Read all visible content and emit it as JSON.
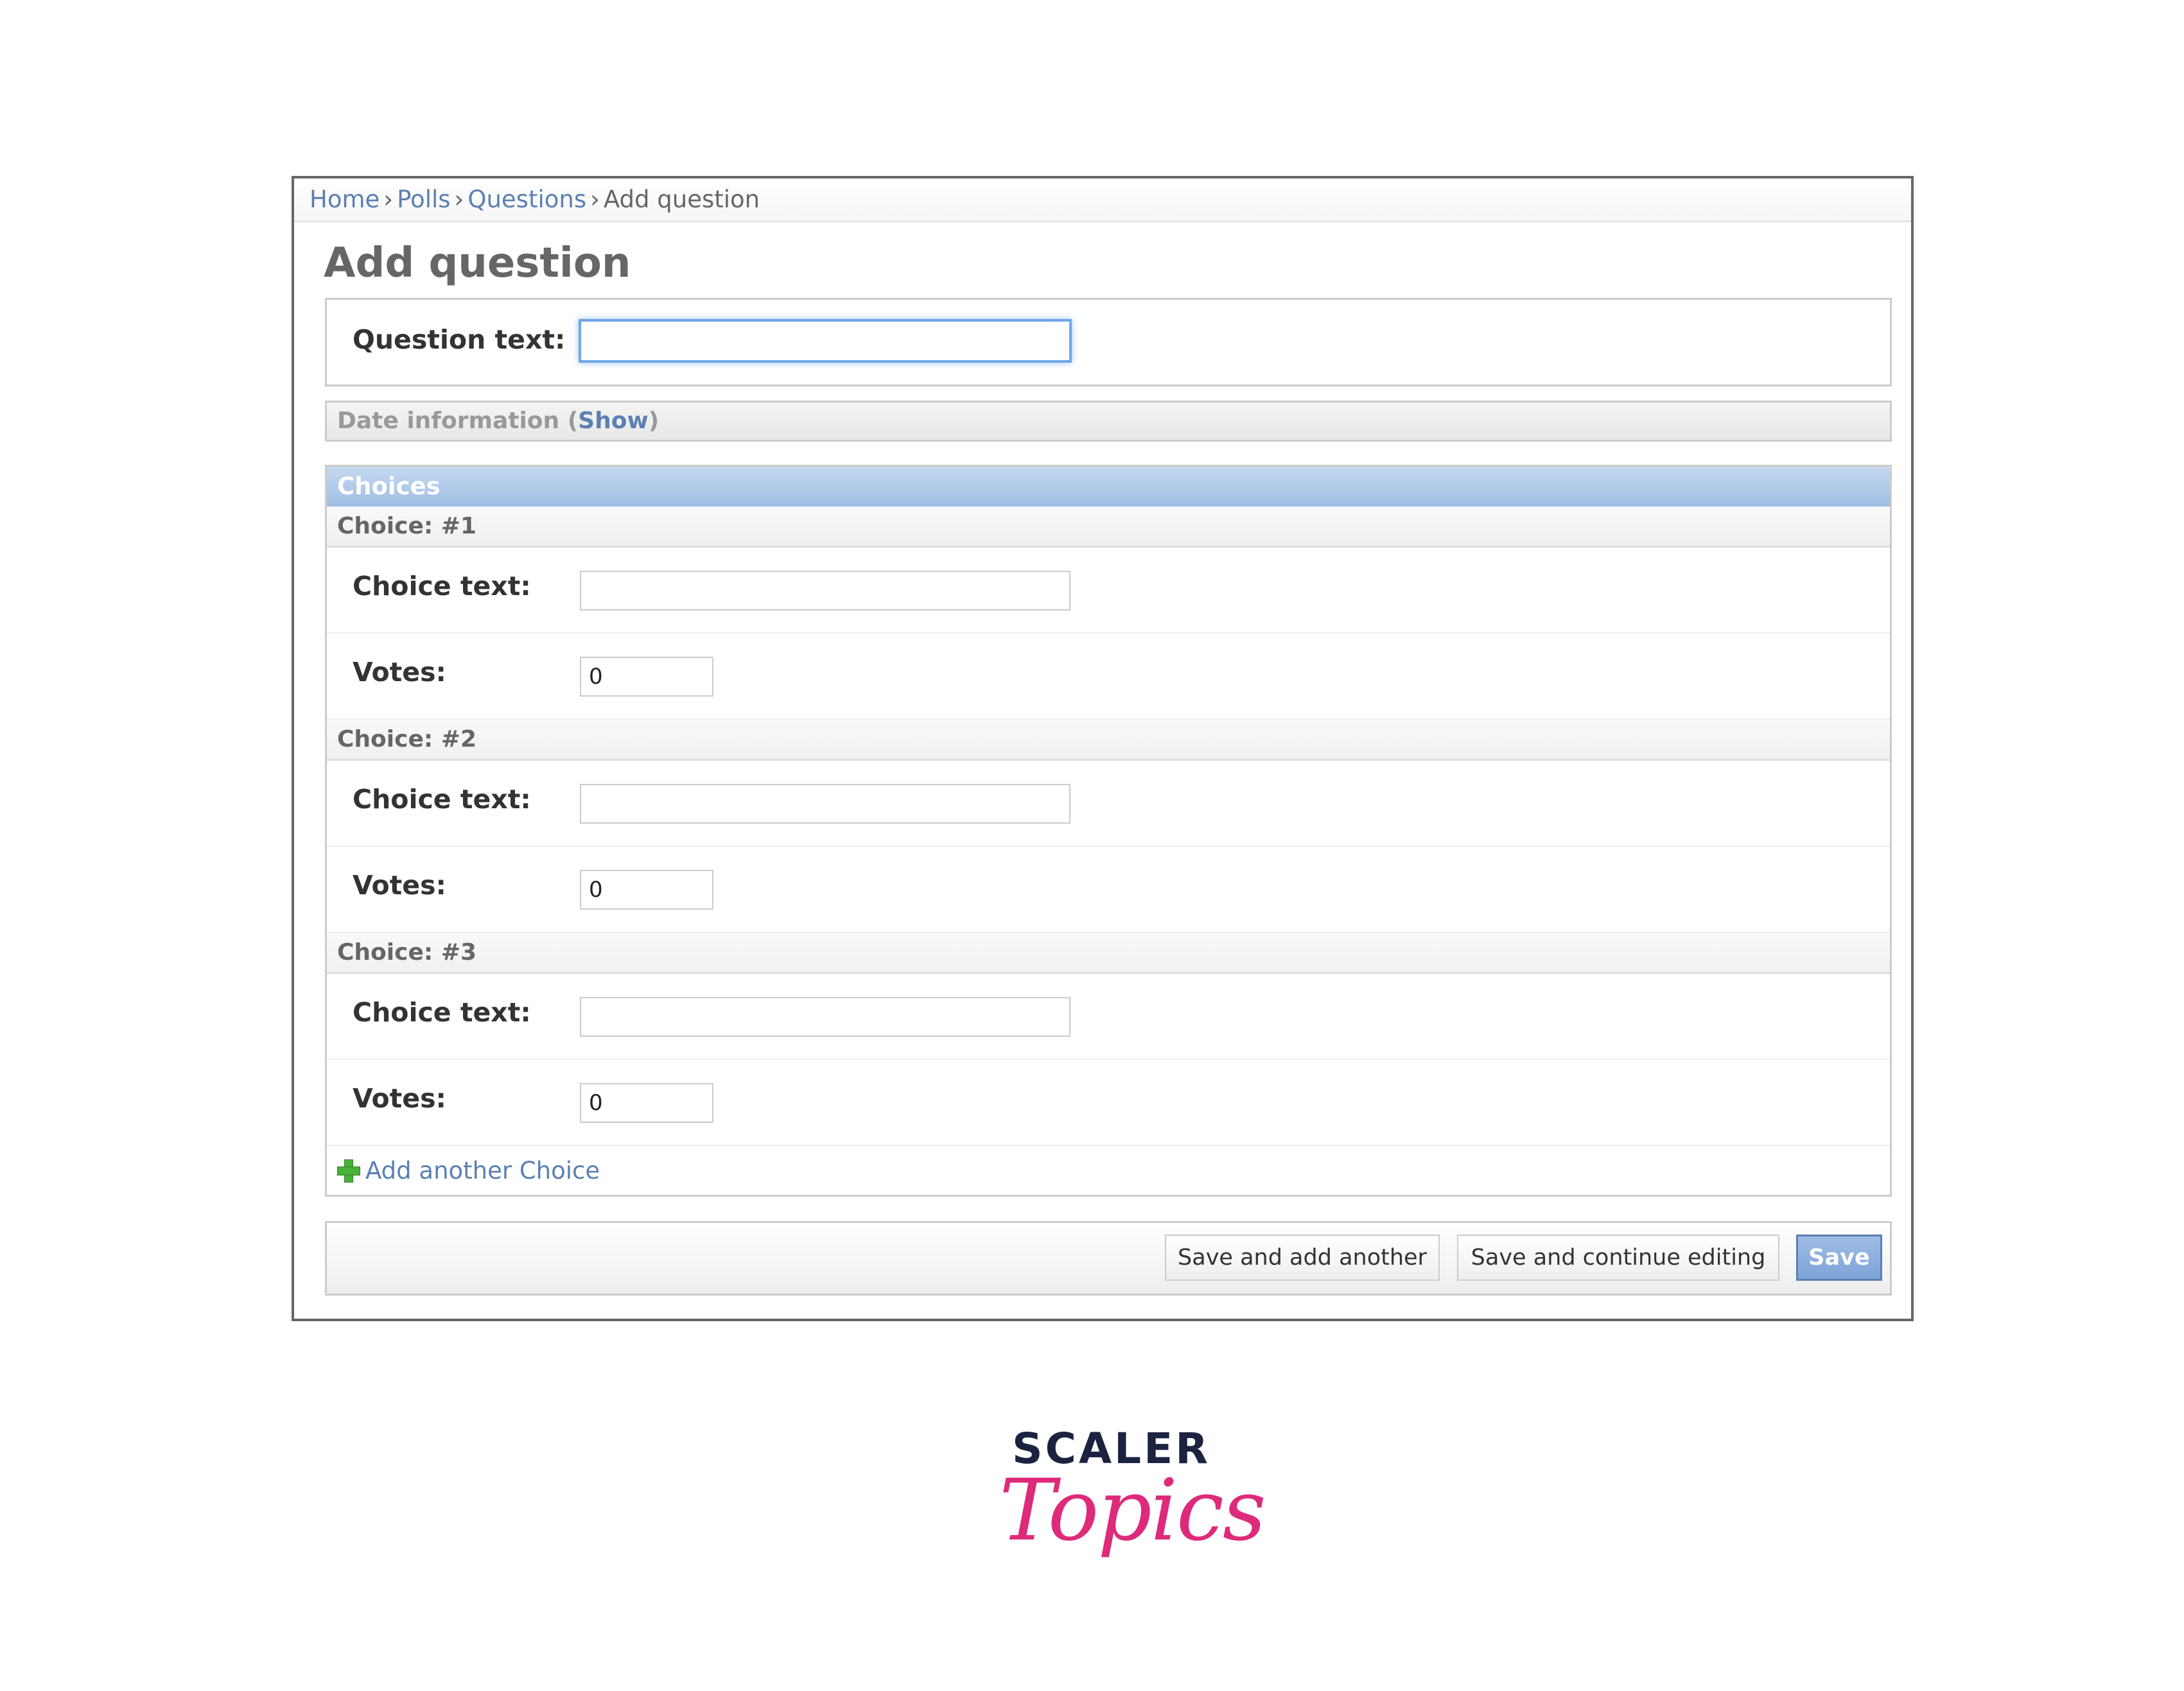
{
  "breadcrumbs": {
    "home": "Home",
    "polls": "Polls",
    "questions": "Questions",
    "current": "Add question",
    "separator": "›"
  },
  "page": {
    "title": "Add question"
  },
  "question_form": {
    "label": "Question text:",
    "value": ""
  },
  "date_section": {
    "label": "Date information",
    "open_paren": "(",
    "toggle": "Show",
    "close_paren": ")"
  },
  "choices": {
    "header": "Choices",
    "items": [
      {
        "title": "Choice: #1",
        "choice_label": "Choice text:",
        "choice_value": "",
        "votes_label": "Votes:",
        "votes_value": "0"
      },
      {
        "title": "Choice: #2",
        "choice_label": "Choice text:",
        "choice_value": "",
        "votes_label": "Votes:",
        "votes_value": "0"
      },
      {
        "title": "Choice: #3",
        "choice_label": "Choice text:",
        "choice_value": "",
        "votes_label": "Votes:",
        "votes_value": "0"
      }
    ],
    "add_another": "Add another Choice"
  },
  "submit": {
    "save_add_another": "Save and add another",
    "save_continue": "Save and continue editing",
    "save": "Save"
  },
  "logo": {
    "top_text": "SCALER",
    "script_text": "Topics"
  },
  "colors": {
    "link": "#5b80b2",
    "header_blue": "#9ebde4",
    "focus_blue": "#6ea6ea",
    "logo_dark": "#1b2340",
    "logo_pink": "#de2a7a",
    "plus_green": "#49b13a"
  }
}
